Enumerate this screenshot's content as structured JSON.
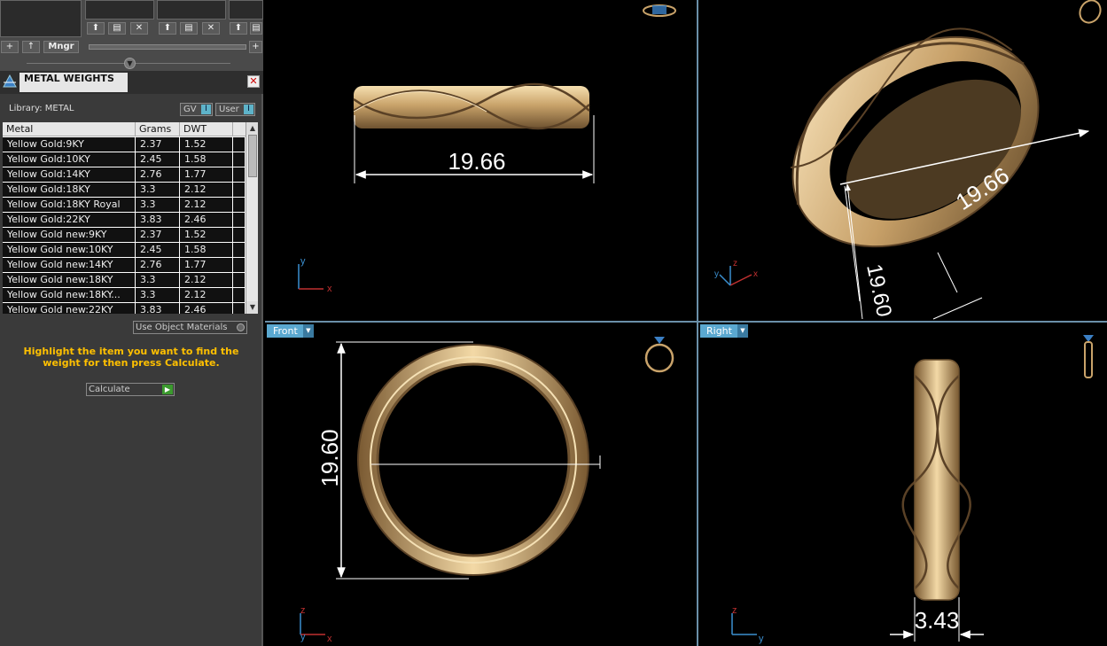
{
  "toolbar": {
    "add": "+",
    "up": "↑",
    "manager": "Mngr",
    "plus_right": "+"
  },
  "panel": {
    "title": "METAL WEIGHTS",
    "close": "✕",
    "library_label": "Library: METAL",
    "gv_label": "GV",
    "user_label": "User",
    "toggle_indicator": "I"
  },
  "table": {
    "columns": [
      "Metal",
      "Grams",
      "DWT"
    ],
    "rows": [
      {
        "metal": "Yellow Gold:9KY",
        "grams": "2.37",
        "dwt": "1.52"
      },
      {
        "metal": "Yellow Gold:10KY",
        "grams": "2.45",
        "dwt": "1.58"
      },
      {
        "metal": "Yellow Gold:14KY",
        "grams": "2.76",
        "dwt": "1.77"
      },
      {
        "metal": "Yellow Gold:18KY",
        "grams": "3.3",
        "dwt": "2.12"
      },
      {
        "metal": "Yellow Gold:18KY Royal",
        "grams": "3.3",
        "dwt": "2.12"
      },
      {
        "metal": "Yellow Gold:22KY",
        "grams": "3.83",
        "dwt": "2.46"
      },
      {
        "metal": "Yellow Gold new:9KY",
        "grams": "2.37",
        "dwt": "1.52"
      },
      {
        "metal": "Yellow Gold new:10KY",
        "grams": "2.45",
        "dwt": "1.58"
      },
      {
        "metal": "Yellow Gold new:14KY",
        "grams": "2.76",
        "dwt": "1.77"
      },
      {
        "metal": "Yellow Gold new:18KY",
        "grams": "3.3",
        "dwt": "2.12"
      },
      {
        "metal": "Yellow Gold new:18KY...",
        "grams": "3.3",
        "dwt": "2.12"
      },
      {
        "metal": "Yellow Gold new:22KY",
        "grams": "3.83",
        "dwt": "2.46"
      }
    ]
  },
  "use_object_materials": "Use Object Materials",
  "hint": "Highlight the item you want to find the weight for then press Calculate.",
  "calculate": "Calculate",
  "viewports": {
    "top": {
      "dimension": "19.66",
      "axis_x": "x",
      "axis_y": "y"
    },
    "perspective": {
      "dimension_width": "19.66",
      "dimension_height": "19.60",
      "axis_x": "x",
      "axis_y": "y",
      "axis_z": "z"
    },
    "front": {
      "label": "Front",
      "dimension": "19.60",
      "axis_x": "x",
      "axis_y": "y",
      "axis_z": "z"
    },
    "right": {
      "label": "Right",
      "dimension": "3.43",
      "axis_y": "y",
      "axis_z": "z"
    }
  },
  "colors": {
    "gold_light": "#f3d9a6",
    "gold_mid": "#c9a36a",
    "gold_dark": "#6e5230",
    "accent_blue": "#5aa8d0",
    "hint_yellow": "#ffc000"
  }
}
